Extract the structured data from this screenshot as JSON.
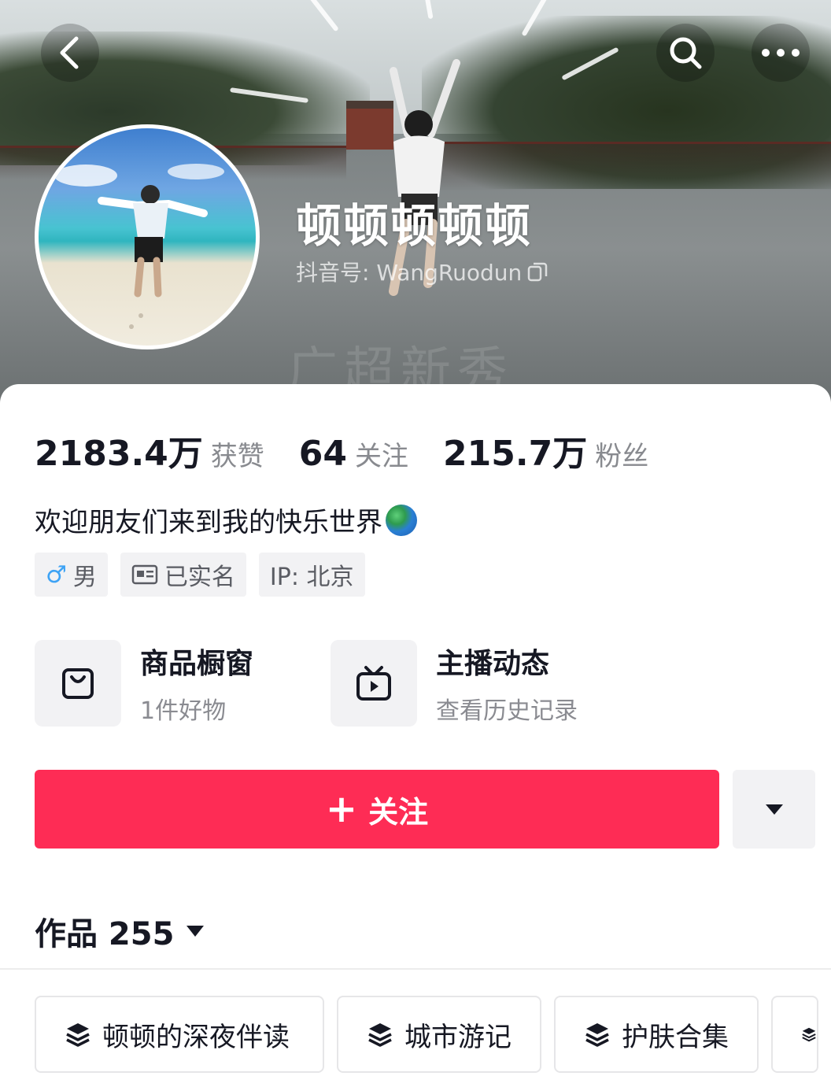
{
  "profile": {
    "nickname": "顿顿顿顿顿",
    "account_id": "抖音号: WangRuodun",
    "watermark": "广超新秀"
  },
  "stats": [
    {
      "value": "2183.4万",
      "label": "获赞"
    },
    {
      "value": "64",
      "label": "关注"
    },
    {
      "value": "215.7万",
      "label": "粉丝"
    }
  ],
  "bio": "欢迎朋友们来到我的快乐世界",
  "tags": {
    "gender_symbol": "♂",
    "gender": "男",
    "verified": "已实名",
    "ip": "IP: 北京"
  },
  "features": [
    {
      "title": "商品橱窗",
      "subtitle": "1件好物",
      "icon": "shopping-bag-icon"
    },
    {
      "title": "主播动态",
      "subtitle": "查看历史记录",
      "icon": "tv-play-icon"
    }
  ],
  "actions": {
    "follow_plus": "+",
    "follow_label": "关注"
  },
  "works": {
    "label": "作品 255"
  },
  "collections": [
    {
      "label": "顿顿的深夜伴读"
    },
    {
      "label": "城市游记"
    },
    {
      "label": "护肤合集"
    }
  ],
  "colors": {
    "accent": "#fe2c55",
    "text_primary": "#161823",
    "text_secondary": "#888a8f",
    "chip_bg": "#f2f2f4"
  }
}
